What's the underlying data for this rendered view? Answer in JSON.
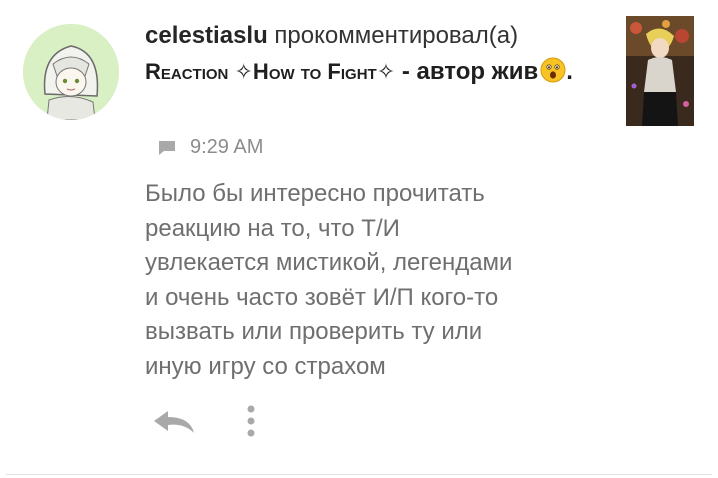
{
  "comment": {
    "username": "celestiaslu",
    "action": "прокомментировал(а)",
    "story_title_caps": "Reaction ✧How to Fight✧",
    "story_title_rest": "- автор жив",
    "story_title_end": ".",
    "time": "9:29 AM",
    "text": "Было бы интересно прочитать\nреакцию на то, что Т/И\nувлекается мистикой, легендами\nи очень часто зовёт И/П кого-то\nвызвать или проверить ту или\nиную игру со страхом"
  },
  "icons": {
    "comment": "speech-bubble-icon",
    "emoji": "astonished-face-emoji",
    "reply": "reply-arrow-icon",
    "more": "vertical-dots-icon"
  },
  "colors": {
    "text_primary": "#262626",
    "text_secondary": "#6f6f6f",
    "meta": "#8c8c8c",
    "icon": "#a9a9a9",
    "avatar_bg": "#d8f0c4"
  }
}
